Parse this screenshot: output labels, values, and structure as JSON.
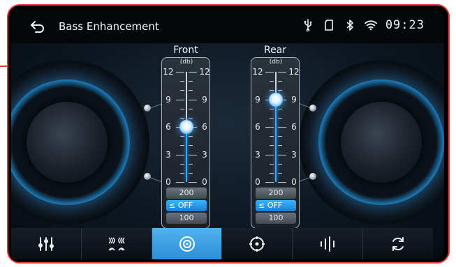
{
  "header": {
    "title": "Bass Enhancement",
    "back_icon": "back-arrow-icon",
    "status_icons": [
      "usb-icon",
      "sd-card-icon",
      "bluetooth-icon",
      "wifi-icon"
    ],
    "time": "09:23"
  },
  "scale": {
    "unit": "(db)",
    "ticks": [
      "12",
      "9",
      "6",
      "3",
      "0"
    ]
  },
  "front": {
    "label": "Front",
    "value_db": 6,
    "max_db": 12,
    "freq_options": [
      "200",
      "≤ OFF",
      "100"
    ],
    "selected_freq": "≤ OFF"
  },
  "rear": {
    "label": "Rear",
    "value_db": 9,
    "max_db": 12,
    "freq_options": [
      "200",
      "≤ OFF",
      "100"
    ],
    "selected_freq": "≤ OFF"
  },
  "toolbar": {
    "items": [
      {
        "icon": "equalizer-sliders-icon",
        "active": false
      },
      {
        "icon": "sound-field-icon",
        "active": false
      },
      {
        "icon": "bass-speaker-icon",
        "active": true
      },
      {
        "icon": "balance-fader-icon",
        "active": false
      },
      {
        "icon": "audio-level-icon",
        "active": false
      },
      {
        "icon": "reset-refresh-icon",
        "active": false
      }
    ]
  },
  "colors": {
    "accent": "#3aa8ff",
    "frame_border": "#e23a3a",
    "active_tab": "#3b9fe2"
  }
}
